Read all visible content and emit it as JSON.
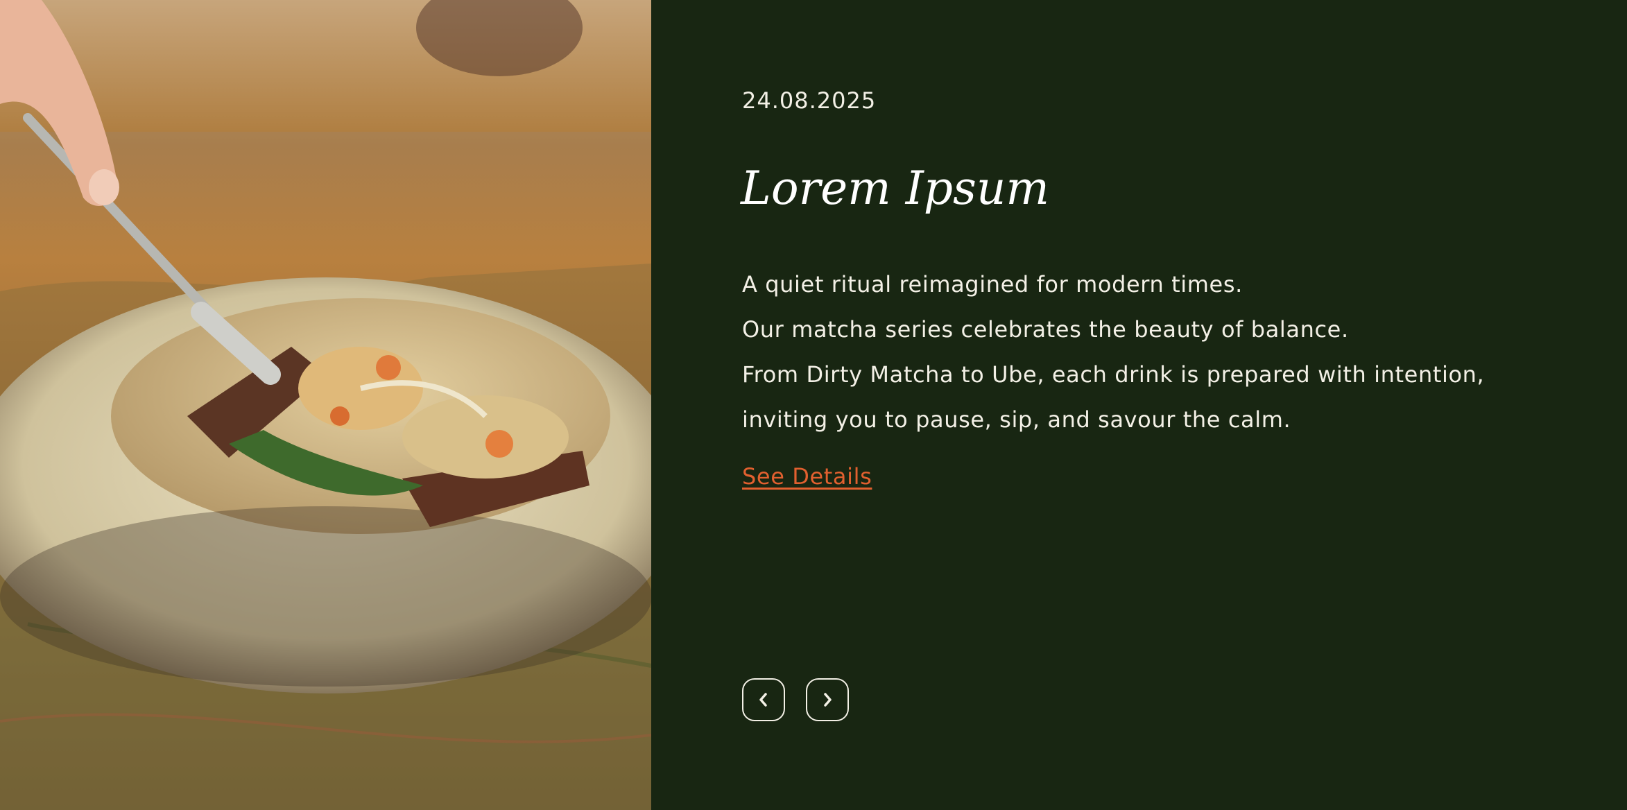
{
  "article": {
    "date": "24.08.2025",
    "title": "Lorem Ipsum",
    "body_lines": [
      "A quiet ritual reimagined for modern times.",
      "Our matcha series celebrates the beauty of balance.",
      "From Dirty Matcha to Ube, each drink is prepared with intention,",
      "inviting you to pause, sip, and savour the calm."
    ],
    "link_label": "See Details"
  },
  "carousel": {
    "prev_icon": "chevron-left-icon",
    "next_icon": "chevron-right-icon"
  },
  "colors": {
    "panel_background": "#182612",
    "text": "#f3f0e6",
    "accent": "#e2602f"
  }
}
